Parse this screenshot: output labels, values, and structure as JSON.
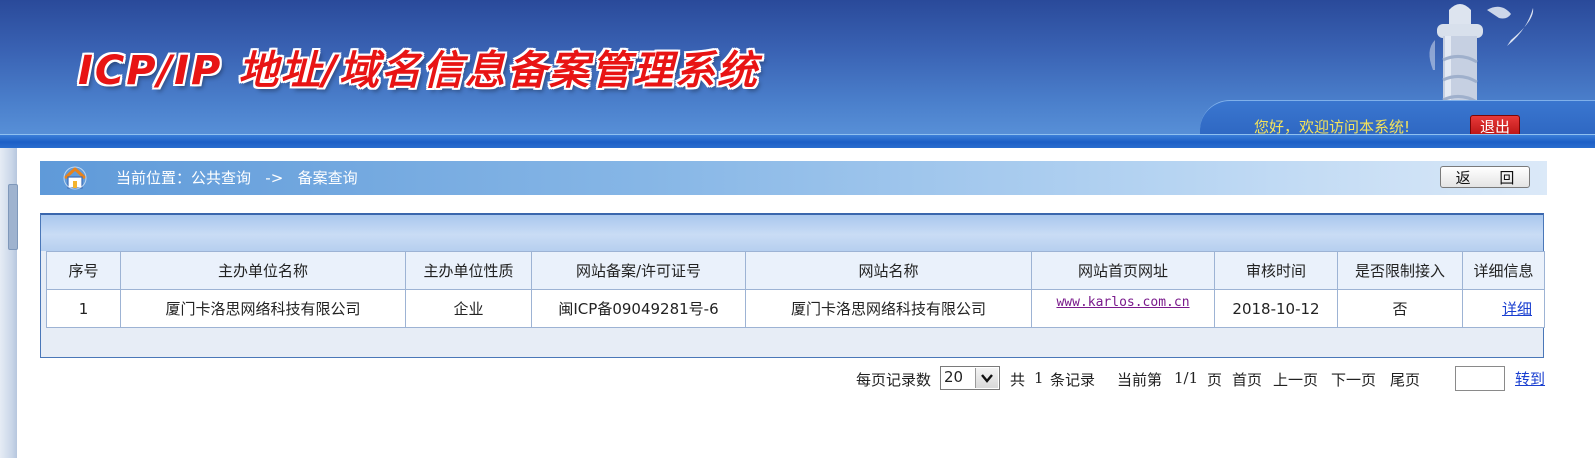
{
  "header": {
    "title": "ICP/IP 地址/域名信息备案管理系统",
    "welcome": "您好，欢迎访问本系统!",
    "logout_label": "退出"
  },
  "breadcrumb": {
    "text": "当前位置：公共查询   ->   备案查询",
    "back_label": "返 回"
  },
  "table": {
    "columns": [
      "序号",
      "主办单位名称",
      "主办单位性质",
      "网站备案/许可证号",
      "网站名称",
      "网站首页网址",
      "审核时间",
      "是否限制接入",
      "详细信息"
    ],
    "rows": [
      {
        "index": "1",
        "org_name": "厦门卡洛思网络科技有限公司",
        "org_type": "企业",
        "license": "闽ICP备09049281号-6",
        "site_name": "厦门卡洛思网络科技有限公司",
        "url": "www.karlos.com.cn",
        "review_date": "2018-10-12",
        "restricted": "否",
        "detail": "详细"
      }
    ]
  },
  "pager": {
    "per_page_label": "每页记录数",
    "per_page_value": "20",
    "total_prefix": "共",
    "total_count": "1",
    "total_suffix": "条记录",
    "current_prefix": "当前第",
    "current_value": "1/1",
    "current_suffix": "页",
    "first": "首页",
    "prev": "上一页",
    "next": "下一页",
    "last": "尾页",
    "goto_label": "转到"
  },
  "colors": {
    "banner": "#3a63b4",
    "title_red": "#e81414",
    "welcome_yellow": "#f5e35a",
    "link_blue": "#1a3fd0",
    "visited_link": "#7a1a8c"
  }
}
